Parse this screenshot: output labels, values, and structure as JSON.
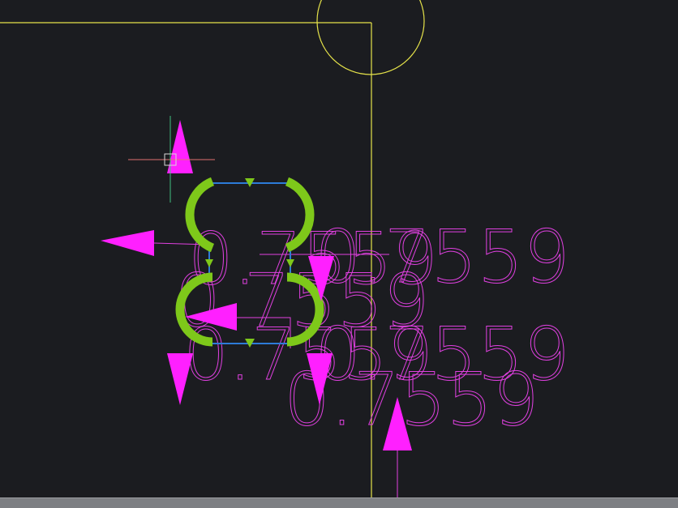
{
  "app": {
    "view": "drawing-canvas"
  },
  "colors": {
    "background": "#1b1c20",
    "boundary": "#e6e34a",
    "dimension": "#e040e0",
    "grip_arrow": "#ff20ff",
    "geometry_selected": "#7ec81a",
    "line_blue": "#2d7bd8",
    "crosshair_red": "#e07070",
    "crosshair_green": "#40c080",
    "status_strip": "#7d7f83"
  },
  "dimensions": [
    {
      "text": "0.7559"
    },
    {
      "text": "0.7559"
    },
    {
      "text": "0.7559"
    },
    {
      "text": "0.7559"
    },
    {
      "text": "0.7559"
    },
    {
      "text": "0.7559"
    }
  ],
  "icons": {
    "cursor": "crosshair-cursor-icon",
    "grip_up": "grip-arrow-up-icon",
    "grip_down": "grip-arrow-down-icon",
    "grip_left": "grip-arrow-left-icon",
    "midpoint": "midpoint-grip-icon"
  }
}
